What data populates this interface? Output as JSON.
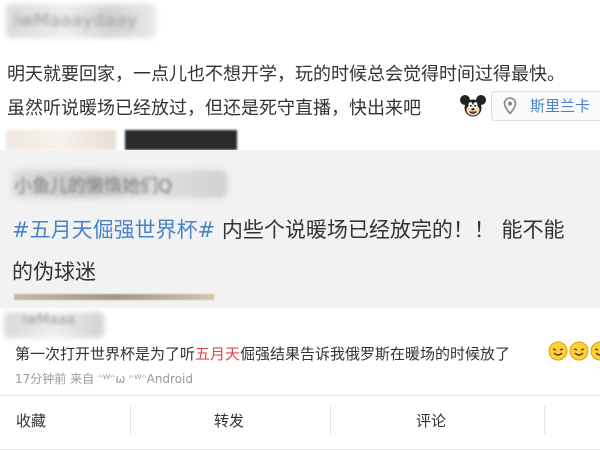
{
  "post": {
    "author_name": "iwMaaaydaay",
    "text_line1": "明天就要回家，一点儿也不想开学，玩的时候总会觉得时间过得最快。",
    "text_line2": "虽然听说暖场已经放过，但还是死守直播，快出来吧",
    "emoji_icon": "mickey-mouse-icon",
    "location": "斯里兰卡",
    "location_icon": "location-pin-icon"
  },
  "repost": {
    "author_name": "小鱼儿的懒惰她们Q",
    "hashtag": "#五月天倔强世界杯#",
    "text_line1_rest": " 内些个说暖场已经放完的！！ 能不能",
    "text_line2": "的伪球迷"
  },
  "comment": {
    "author_name": "iwMaaa",
    "text_before": "第一次打开世界杯是为了听",
    "text_highlight": "五月天",
    "text_after": "倔强结果告诉我俄罗斯在暖场的时候放了",
    "time": "17分钟前",
    "source_prefix": "来自",
    "source": "ᵔᵂᵔω ᵔᵂᵔAndroid"
  },
  "actions": {
    "favorite": "收藏",
    "repost": "转发",
    "comment": "评论"
  },
  "colors": {
    "link_blue": "#4a84c7",
    "highlight_red": "#e0474a",
    "meta_gray": "#999999",
    "repost_bg": "#f2f2f2"
  }
}
